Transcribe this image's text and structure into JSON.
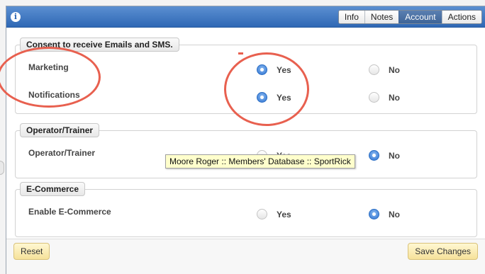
{
  "colors": {
    "titlebar": "#3f76c0",
    "accent": "#2a6fd0",
    "annotation": "#e8604f",
    "button": "#f6e29a",
    "tooltip_bg": "#ffffcc"
  },
  "titlebar": {
    "icon": "info-icon",
    "icon_glyph": "i"
  },
  "tabs": [
    {
      "label": "Info",
      "active": false
    },
    {
      "label": "Notes",
      "active": false
    },
    {
      "label": "Account",
      "active": true
    },
    {
      "label": "Actions",
      "active": false
    }
  ],
  "sections": {
    "consent": {
      "legend": "Consent to receive Emails and SMS.",
      "rows": [
        {
          "label": "Marketing",
          "yes": "Yes",
          "no": "No",
          "selected": "Yes"
        },
        {
          "label": "Notifications",
          "yes": "Yes",
          "no": "No",
          "selected": "Yes"
        }
      ]
    },
    "operator": {
      "legend": "Operator/Trainer",
      "rows": [
        {
          "label": "Operator/Trainer",
          "yes": "Yes",
          "no": "No",
          "selected": "No"
        }
      ]
    },
    "ecommerce": {
      "legend": "E-Commerce",
      "rows": [
        {
          "label": "Enable E-Commerce",
          "yes": "Yes",
          "no": "No",
          "selected": "No"
        }
      ]
    }
  },
  "tooltip": "Moore Roger :: Members' Database :: SportRick",
  "footer": {
    "reset_label": "Reset",
    "save_label": "Save Changes"
  }
}
